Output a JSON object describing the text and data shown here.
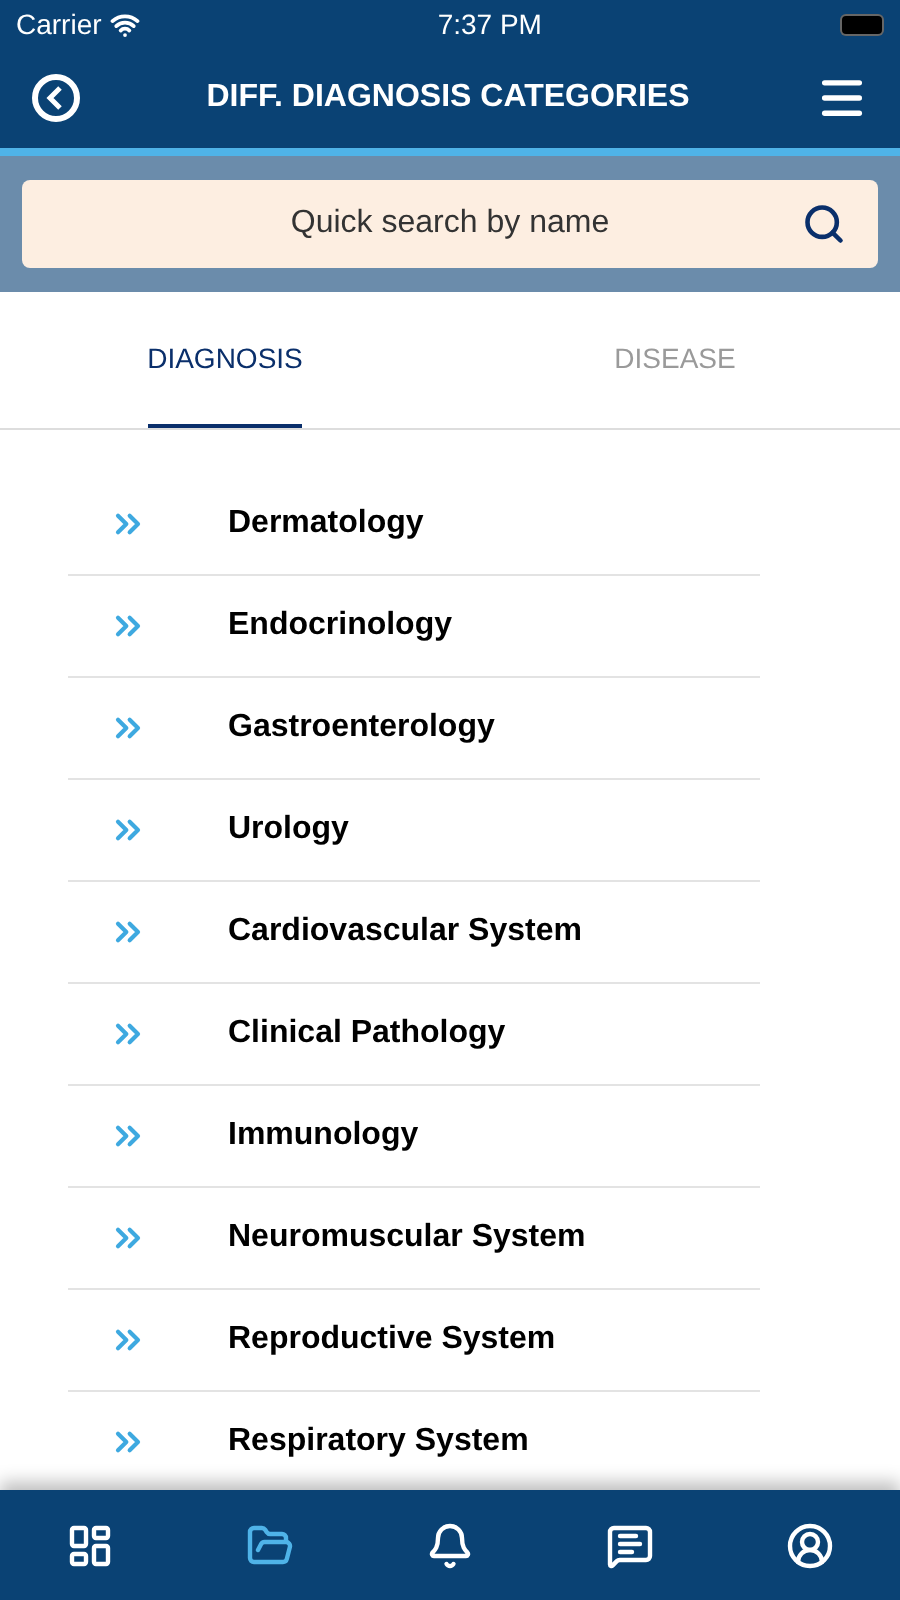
{
  "status_bar": {
    "carrier": "Carrier",
    "time": "7:37 PM"
  },
  "header": {
    "title": "DIFF. DIAGNOSIS CATEGORIES"
  },
  "search": {
    "placeholder": "Quick search by name"
  },
  "tabs": [
    {
      "label": "DIAGNOSIS",
      "selected": true
    },
    {
      "label": "DISEASE",
      "selected": false
    }
  ],
  "categories": [
    "Dermatology",
    "Endocrinology",
    "Gastroenterology",
    "Urology",
    "Cardiovascular System",
    "Clinical Pathology",
    "Immunology",
    "Neuromuscular System",
    "Reproductive System",
    "Respiratory System"
  ],
  "bottom_nav": [
    {
      "kind": "dashboard",
      "selected": false
    },
    {
      "kind": "folder",
      "selected": true
    },
    {
      "kind": "bell",
      "selected": false
    },
    {
      "kind": "feedback",
      "selected": false
    },
    {
      "kind": "profile",
      "selected": false
    }
  ]
}
